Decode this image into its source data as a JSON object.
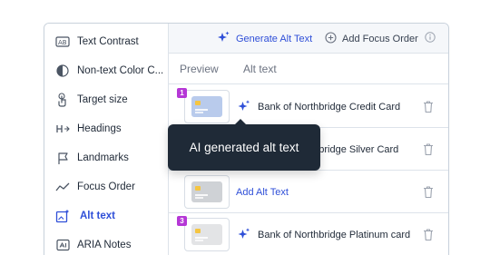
{
  "sidebar": {
    "items": [
      {
        "label": "Text Contrast",
        "icon": "text-contrast-icon"
      },
      {
        "label": "Non-text Color C...",
        "icon": "color-contrast-icon"
      },
      {
        "label": "Target size",
        "icon": "touch-target-icon"
      },
      {
        "label": "Headings",
        "icon": "heading-icon"
      },
      {
        "label": "Landmarks",
        "icon": "flag-icon"
      },
      {
        "label": "Focus Order",
        "icon": "focus-path-icon"
      },
      {
        "label": "Alt text",
        "icon": "image-sparkle-icon",
        "active": true
      },
      {
        "label": "ARIA Notes",
        "icon": "aria-note-icon"
      }
    ]
  },
  "toolbar": {
    "generate_label": "Generate Alt Text",
    "focus_label": "Add Focus Order"
  },
  "tabs": {
    "preview": "Preview",
    "alt_text": "Alt text"
  },
  "rows": [
    {
      "badge": "1",
      "text": "Bank of Northbridge Credit Card",
      "card_color": "#b9cbec"
    },
    {
      "badge": "",
      "text": "Bank of Northbridge Silver Card",
      "card_color": "#c8ccd4"
    },
    {
      "badge": "",
      "add_label": "Add Alt Text",
      "card_color": "#cfd2d6"
    },
    {
      "badge": "3",
      "text": "Bank of Northbridge Platinum card",
      "card_color": "#e3e4e6"
    }
  ],
  "tooltip": {
    "text": "AI generated alt text"
  },
  "colors": {
    "accent": "#2f4fd8",
    "badge": "#b537d6",
    "tooltip_bg": "#1f2a37",
    "chip": "#f5c542"
  }
}
